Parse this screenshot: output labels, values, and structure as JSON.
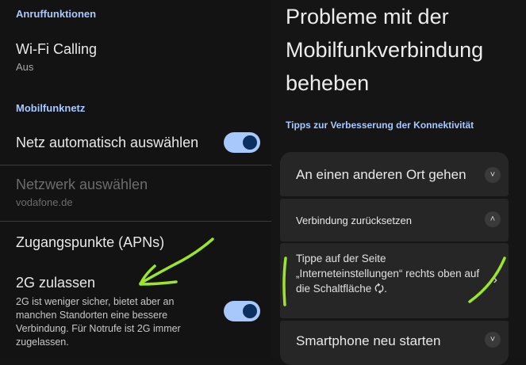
{
  "left": {
    "section_calls": "Anruffunktionen",
    "wifi_calling": {
      "title": "Wi-Fi Calling",
      "status": "Aus"
    },
    "section_network": "Mobilfunknetz",
    "auto_network": {
      "title": "Netz automatisch auswählen",
      "enabled": true
    },
    "select_network": {
      "title": "Netzwerk auswählen",
      "value": "vodafone.de"
    },
    "apn": {
      "title": "Zugangspunkte (APNs)"
    },
    "allow_2g": {
      "title": "2G zulassen",
      "description": "2G ist weniger sicher, bietet aber an manchen Standorten eine bessere Verbindung. Für Notrufe ist 2G immer zugelassen.",
      "enabled": true
    }
  },
  "right": {
    "heading": "Probleme mit der Mobilfunkverbindung beheben",
    "tips_heading": "Tipps zur Verbesserung der Konnektivität",
    "cards": [
      {
        "label": "An einen anderen Ort gehen",
        "state": "collapsed"
      },
      {
        "label": "Verbindung zurücksetzen",
        "state": "expanded",
        "body": "Tippe auf der Seite „Interneteinstellungen“ rechts oben auf die Schaltfläche 🗘."
      },
      {
        "label": "Smartphone neu starten",
        "state": "collapsed"
      }
    ]
  },
  "icons": {
    "chevron_down": "˅",
    "chevron_up": "˄",
    "chevron_right": "›"
  },
  "colors": {
    "accent": "#a8c7fa",
    "toggle_knob": "#0b305f",
    "annotation": "#9be62a"
  }
}
